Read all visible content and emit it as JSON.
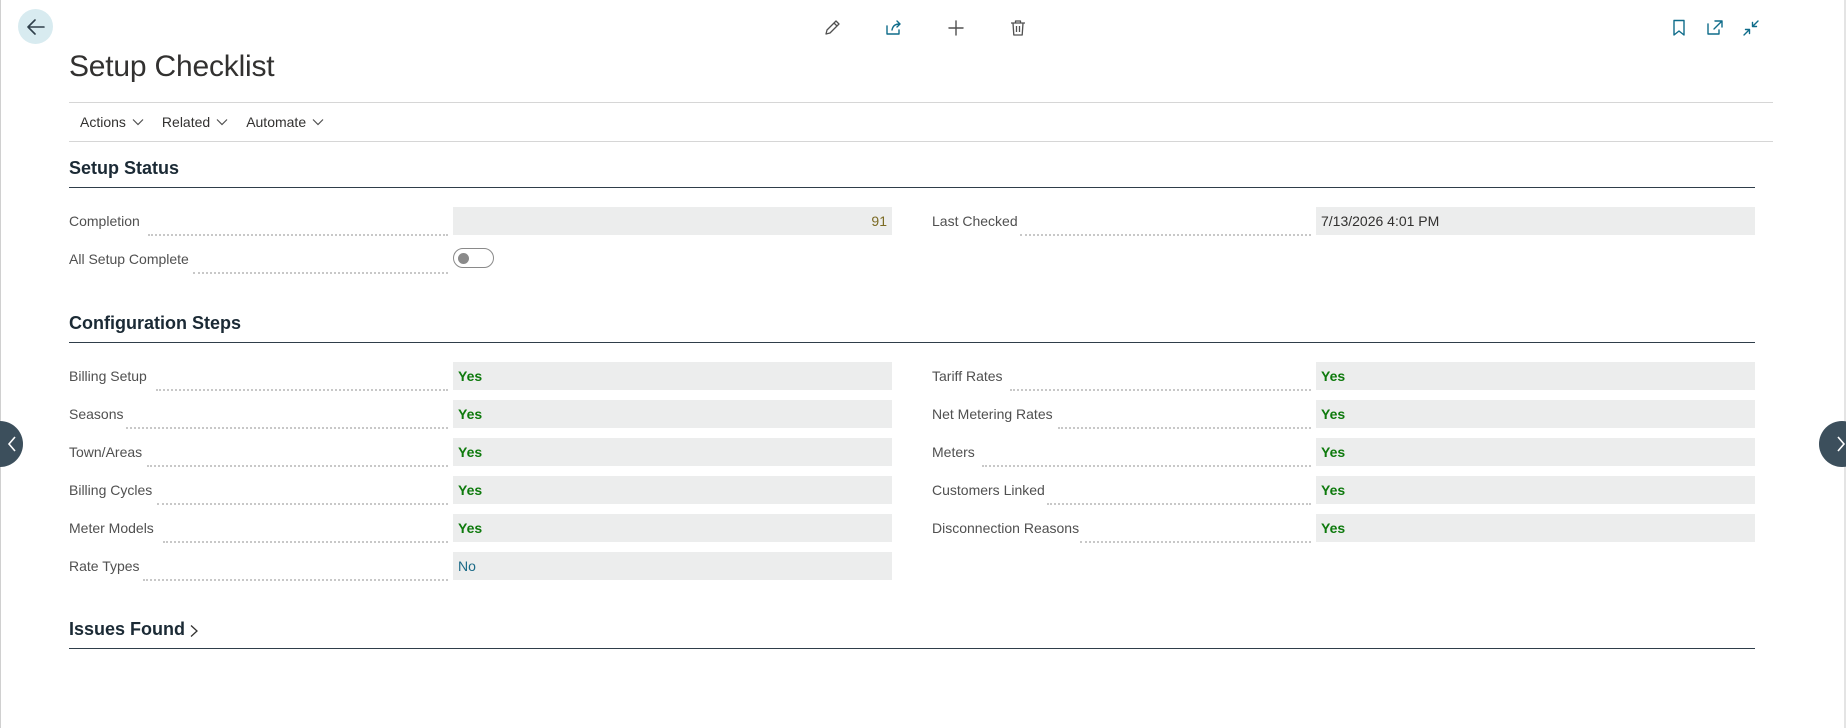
{
  "page": {
    "title": "Setup Checklist"
  },
  "action_bar": {
    "items": [
      {
        "label": "Actions"
      },
      {
        "label": "Related"
      },
      {
        "label": "Automate"
      }
    ]
  },
  "setup_status": {
    "title": "Setup Status",
    "completion": {
      "label": "Completion",
      "value": "91"
    },
    "last_checked": {
      "label": "Last Checked",
      "value": "7/13/2026 4:01 PM"
    },
    "all_setup_complete": {
      "label": "All Setup Complete",
      "value": false
    }
  },
  "configuration_steps": {
    "title": "Configuration Steps",
    "left": [
      {
        "label": "Billing Setup",
        "value": "Yes"
      },
      {
        "label": "Seasons",
        "value": "Yes"
      },
      {
        "label": "Town/Areas",
        "value": "Yes"
      },
      {
        "label": "Billing Cycles",
        "value": "Yes"
      },
      {
        "label": "Meter Models",
        "value": "Yes"
      },
      {
        "label": "Rate Types",
        "value": "No"
      }
    ],
    "right": [
      {
        "label": "Tariff Rates",
        "value": "Yes"
      },
      {
        "label": "Net Metering Rates",
        "value": "Yes"
      },
      {
        "label": "Meters",
        "value": "Yes"
      },
      {
        "label": "Customers Linked",
        "value": "Yes"
      },
      {
        "label": "Disconnection Reasons",
        "value": "Yes"
      }
    ]
  },
  "issues_found": {
    "title": "Issues Found"
  },
  "colors": {
    "accent": "#0f6c8a",
    "yes": "#0e7a0d",
    "no": "#1b6a87"
  }
}
